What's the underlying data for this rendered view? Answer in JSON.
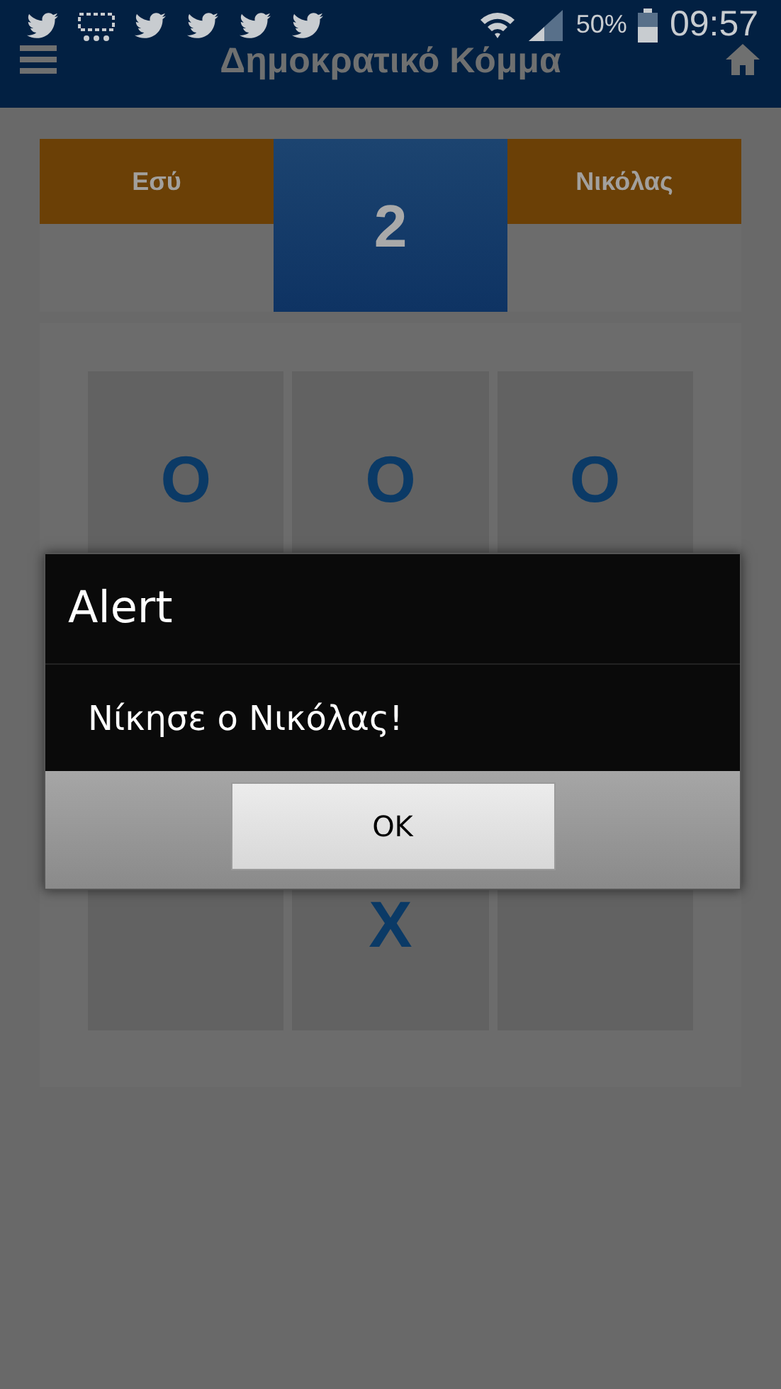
{
  "status_bar": {
    "battery": "50%",
    "time": "09:57"
  },
  "header": {
    "title": "Δημοκρατικό Κόμμα"
  },
  "scoreboard": {
    "players": [
      "Εσύ",
      "Νικόλας"
    ],
    "round": "2"
  },
  "board": {
    "rows": [
      [
        {
          "mark": "O"
        },
        {
          "mark": "O"
        },
        {
          "mark": "O"
        }
      ],
      [
        {},
        {
          "mark": "X"
        },
        {}
      ]
    ]
  },
  "dialog": {
    "title": "Alert",
    "message": "Νίκησε ο Νικόλας!",
    "button": "OK"
  }
}
